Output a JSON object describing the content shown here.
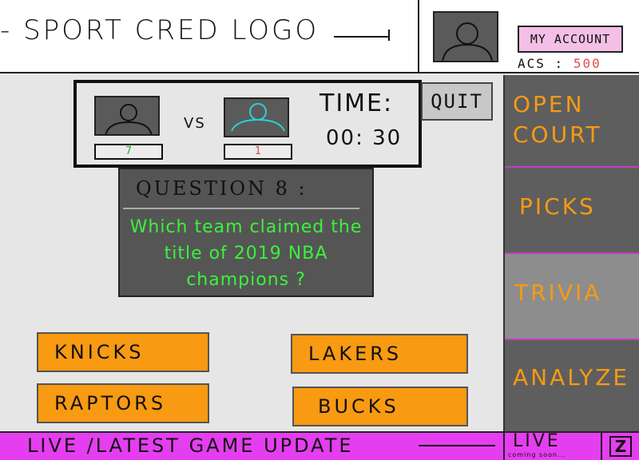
{
  "header": {
    "logo_text": "- SPORT CRED LOGO",
    "account_label": "MY ACCOUNT",
    "acs_label": "ACS :",
    "acs_value": "500"
  },
  "match": {
    "vs": "VS",
    "player1_score": "7",
    "player2_score": "1",
    "time_label": "TIME:",
    "time_value": "00: 30"
  },
  "quit_label": "QUIT",
  "question": {
    "heading": "QUESTION  8 :",
    "text": "Which team claimed the title of 2019 NBA champions ?"
  },
  "answers": [
    "KNICKS",
    "LAKERS",
    "RAPTORS",
    "BUCKS"
  ],
  "sidebar": {
    "items": [
      {
        "label": "OPEN COURT",
        "active": false
      },
      {
        "label": "PICKS",
        "active": false
      },
      {
        "label": "TRIVIA",
        "active": true
      },
      {
        "label": "ANALYZE",
        "active": false
      }
    ]
  },
  "bottom_bar": {
    "text": "LIVE /LATEST GAME UPDATE",
    "live_label": "LIVE",
    "live_sub": "coming soon...",
    "z_label": "Z"
  },
  "colors": {
    "accent_orange": "#f89a12",
    "question_green": "#3cf23c",
    "bottom_bar_magenta": "#e53ef0",
    "account_pink": "#f3bfe6",
    "panel_gray": "#555555"
  }
}
